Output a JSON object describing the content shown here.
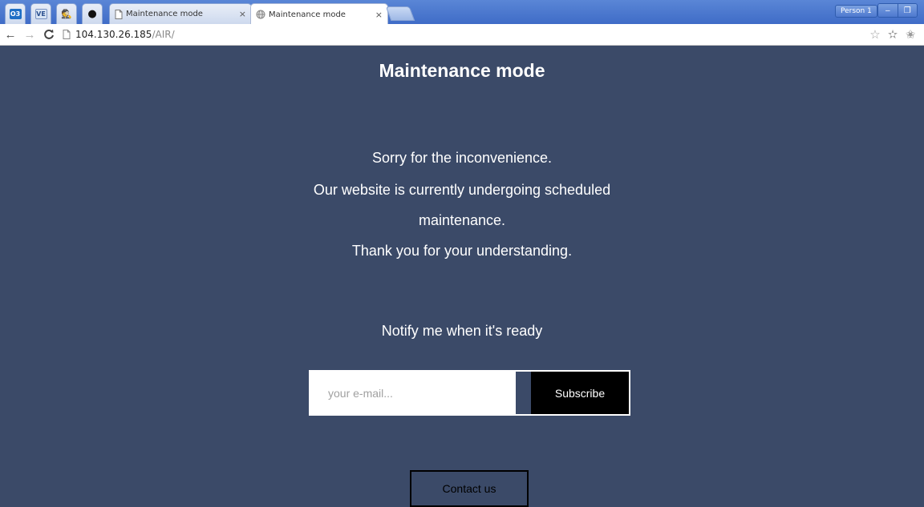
{
  "browser": {
    "tabs": [
      {
        "icon": "outlook-icon",
        "text": "O3"
      },
      {
        "icon": "ve-icon",
        "text": "VE"
      },
      {
        "icon": "spy-icon",
        "text": "🕵"
      },
      {
        "icon": "github-icon",
        "text": "●"
      },
      {
        "icon": "page-icon",
        "title": "Maintenance mode"
      },
      {
        "icon": "globe-icon",
        "title": "Maintenance mode"
      }
    ],
    "tab_close": "×",
    "profile_label": "Person 1",
    "url_host": "104.130.26.185",
    "url_path": "/AIR/",
    "colors": {
      "tab_strip": "#4a77cf",
      "page_bg": "#3b4a68"
    }
  },
  "page": {
    "title": "Maintenance mode",
    "message_lines": [
      "Sorry for the inconvenience.",
      "Our website is currently undergoing scheduled",
      "maintenance.",
      "Thank you for your understanding."
    ],
    "notify_label": "Notify me when it's ready",
    "email_placeholder": "your e-mail...",
    "subscribe_label": "Subscribe",
    "contact_label": "Contact us"
  }
}
